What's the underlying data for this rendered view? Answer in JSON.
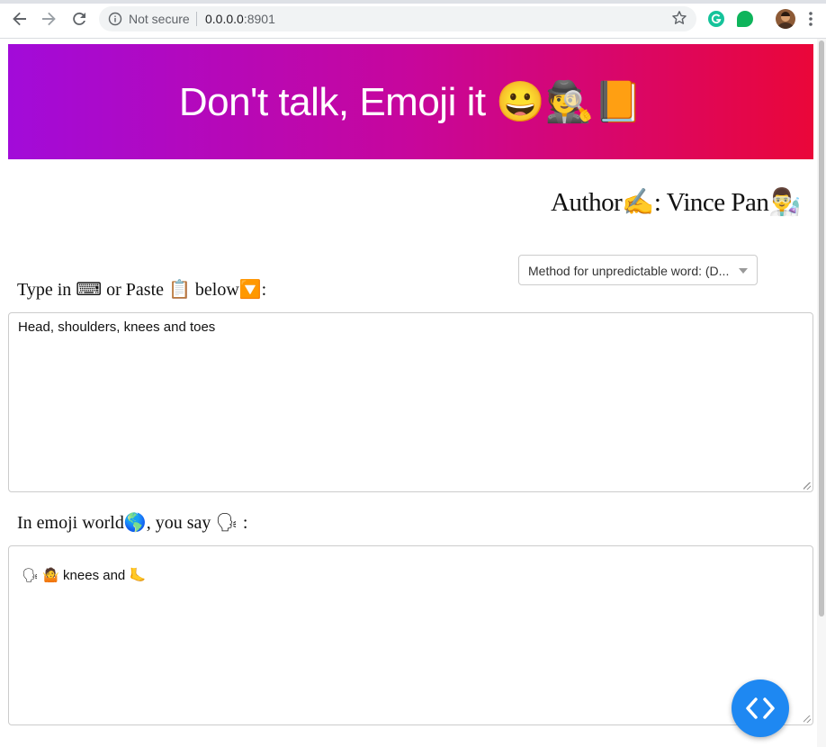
{
  "browser": {
    "security_label": "Not secure",
    "url_host": "0.0.0.0",
    "url_port": ":8901"
  },
  "banner": {
    "title": "Don't talk, Emoji it 😀🕵📙"
  },
  "author": {
    "text": "Author✍: Vince Pan👨‍🔬"
  },
  "method_select": {
    "value": "Method for unpredictable word: (D..."
  },
  "input_section": {
    "label": "Type in ⌨ or Paste 📋 below🔽:",
    "value": "Head, shoulders, knees and toes"
  },
  "output_section": {
    "label": "In emoji world🌎, you say 🗣 :",
    "value": "🗣 🤷 knees and 🦶"
  },
  "colors": {
    "banner_gradient_start": "#a20bd9",
    "banner_gradient_end": "#ea0639",
    "fab": "#1e88f2"
  },
  "icons": {
    "fab": "code-brackets-icon"
  }
}
